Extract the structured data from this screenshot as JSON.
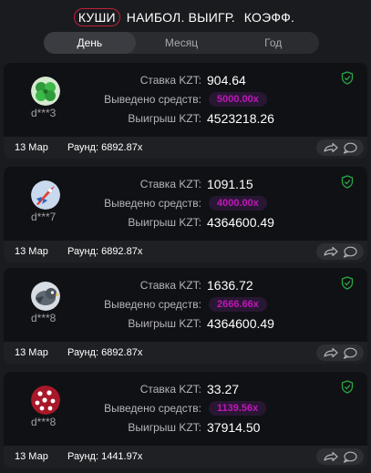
{
  "top_tabs": [
    {
      "label": "КУШИ",
      "active": true
    },
    {
      "label": "НАИБОЛ. ВЫИГР.",
      "active": false
    },
    {
      "label": "КОЭФФ.",
      "active": false
    }
  ],
  "period_tabs": [
    {
      "label": "День",
      "active": true
    },
    {
      "label": "Месяц",
      "active": false
    },
    {
      "label": "Год",
      "active": false
    }
  ],
  "labels": {
    "bet": "Ставка KZT:",
    "cashout": "Выведено средств:",
    "win": "Выигрыш KZT:",
    "round": "Раунд:"
  },
  "colors": {
    "accent_ring": "#c0213a",
    "multiplier_text": "#c017b8",
    "shield_green": "#27a844"
  },
  "cards": [
    {
      "username": "d***3",
      "avatar": "clover-avatar",
      "bet": "904.64",
      "cashout": "5000.00x",
      "win": "4523218.26",
      "date": "13 Мар",
      "round": "6892.87x"
    },
    {
      "username": "d***7",
      "avatar": "rocket-avatar",
      "bet": "1091.15",
      "cashout": "4000.00x",
      "win": "4364600.49",
      "date": "13 Мар",
      "round": "6892.87x"
    },
    {
      "username": "d***8",
      "avatar": "bird-avatar",
      "bet": "1636.72",
      "cashout": "2666.66x",
      "win": "4364600.49",
      "date": "13 Мар",
      "round": "6892.87x"
    },
    {
      "username": "d***8",
      "avatar": "dice-avatar",
      "bet": "33.27",
      "cashout": "1139.56x",
      "win": "37914.50",
      "date": "13 Мар",
      "round": "1441.97x"
    }
  ]
}
